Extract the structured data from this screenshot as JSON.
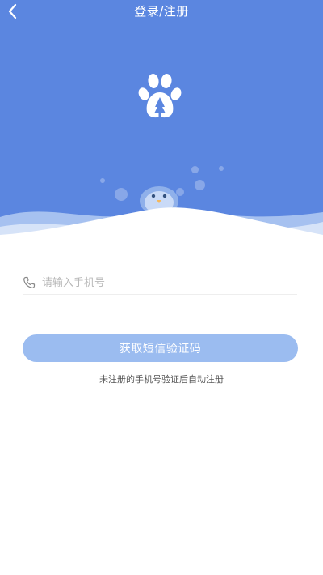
{
  "header": {
    "title": "登录/注册",
    "back_icon": "chevron-left-icon"
  },
  "hero": {
    "logo_icon": "paw-print-icon",
    "mascot_icon": "penguin-mascot-icon",
    "background_color": "#5b86e0"
  },
  "form": {
    "phone_icon": "phone-icon",
    "phone_placeholder": "请输入手机号",
    "phone_value": "",
    "submit_label": "获取短信验证码",
    "submit_color": "#9bbcf0",
    "note": "未注册的手机号验证后自动注册"
  }
}
